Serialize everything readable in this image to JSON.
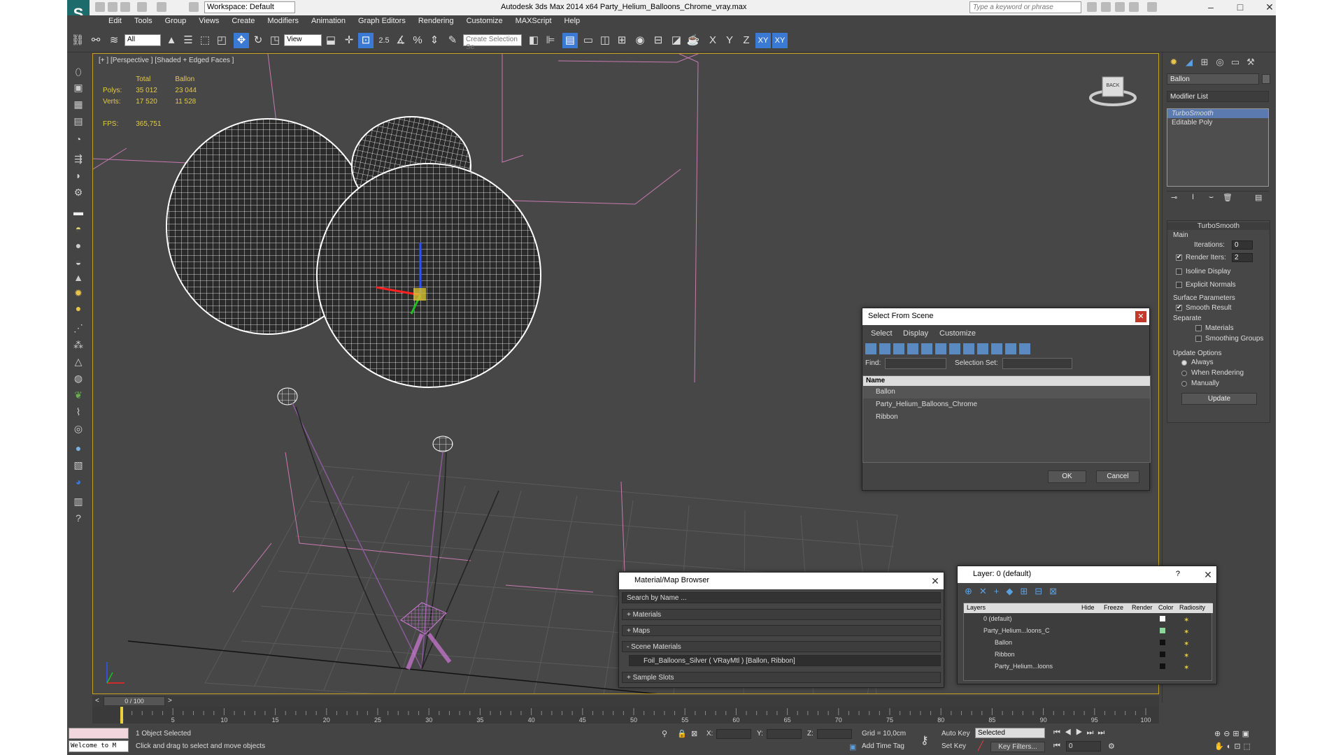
{
  "app": {
    "title": "Autodesk 3ds Max  2014 x64    Party_Helium_Balloons_Chrome_vray.max",
    "workspace": "Workspace: Default",
    "search_placeholder": "Type a keyword or phrase"
  },
  "menu": [
    "Edit",
    "Tools",
    "Group",
    "Views",
    "Create",
    "Modifiers",
    "Animation",
    "Graph Editors",
    "Rendering",
    "Customize",
    "MAXScript",
    "Help"
  ],
  "toolbar": {
    "selection_filter": "All",
    "ref_coord": "View",
    "angle_snap": "2.5",
    "named_selection_placeholder": "Create Selection Se",
    "axes": [
      "X",
      "Y",
      "Z",
      "XY",
      "XY"
    ]
  },
  "viewport": {
    "label": "[+ ] [Perspective ] [Shaded + Edged Faces ]",
    "stats": {
      "col_total": "Total",
      "col_sel": "Ballon",
      "polys_label": "Polys:",
      "polys_total": "35 012",
      "polys_sel": "23 044",
      "verts_label": "Verts:",
      "verts_total": "17 520",
      "verts_sel": "11 528",
      "fps_label": "FPS:",
      "fps": "365,751"
    },
    "viewcube_label": "BACK"
  },
  "command_panel": {
    "object_name": "Ballon",
    "modifier_list": "Modifier List",
    "stack": [
      "TurboSmooth",
      "Editable Poly"
    ],
    "turbosmooth": {
      "title": "TurboSmooth",
      "main": "Main",
      "iterations_label": "Iterations:",
      "iterations": "0",
      "render_iters_label": "Render Iters:",
      "render_iters": "2",
      "isoline": "Isoline Display",
      "explicit": "Explicit Normals",
      "surface_params": "Surface Parameters",
      "smooth_result": "Smooth Result",
      "separate": "Separate",
      "materials": "Materials",
      "smoothing_groups": "Smoothing Groups",
      "update_options": "Update Options",
      "always": "Always",
      "when_rendering": "When Rendering",
      "manually": "Manually",
      "update_btn": "Update"
    }
  },
  "select_from_scene": {
    "title": "Select From Scene",
    "menu": [
      "Select",
      "Display",
      "Customize"
    ],
    "find_label": "Find:",
    "selection_set_label": "Selection Set:",
    "col_name": "Name",
    "items": [
      "Ballon",
      "Party_Helium_Balloons_Chrome",
      "Ribbon"
    ],
    "ok": "OK",
    "cancel": "Cancel"
  },
  "material_browser": {
    "title": "Material/Map Browser",
    "search": "Search by Name ...",
    "groups": [
      "+ Materials",
      "+ Maps",
      "- Scene Materials"
    ],
    "scene_material": "Foil_Balloons_Silver  ( VRayMtl )  [Ballon, Ribbon]",
    "sample_slots": "+ Sample Slots"
  },
  "layer_dialog": {
    "title": "Layer: 0 (default)",
    "help": "?",
    "cols": [
      "Layers",
      "Hide",
      "Freeze",
      "Render",
      "Color",
      "Radiosity"
    ],
    "rows": [
      "0 (default)",
      "Party_Helium...loons_C",
      "Ballon",
      "Ribbon",
      "Party_Helium...loons"
    ]
  },
  "timeline": {
    "frame": "0 / 100",
    "ticks": [
      "0",
      "5",
      "10",
      "15",
      "20",
      "25",
      "30",
      "35",
      "40",
      "45",
      "50",
      "55",
      "60",
      "65",
      "70",
      "75",
      "80",
      "85",
      "90",
      "95",
      "100"
    ]
  },
  "status": {
    "maxscript": "Welcome to M",
    "selected": "1 Object Selected",
    "prompt": "Click and drag to select and move objects",
    "x_label": "X:",
    "y_label": "Y:",
    "z_label": "Z:",
    "grid": "Grid = 10,0cm",
    "auto_key": "Auto Key",
    "set_key": "Set Key",
    "key_mode": "Selected",
    "key_filters": "Key Filters...",
    "add_time_tag": "Add Time Tag",
    "frame_field": "0"
  }
}
